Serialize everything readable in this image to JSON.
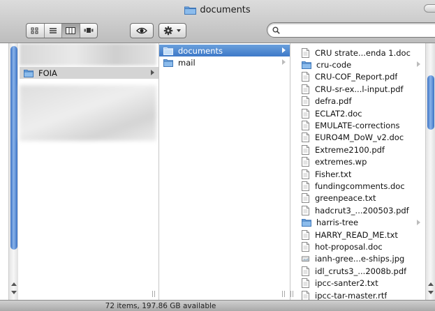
{
  "window": {
    "title": "documents"
  },
  "search": {
    "value": "",
    "placeholder": ""
  },
  "sidebar": {
    "items": [
      {
        "label": "FOIA",
        "icon": "folder-icon"
      }
    ]
  },
  "middle": {
    "items": [
      {
        "label": "documents",
        "icon": "folder-icon",
        "selected": true
      },
      {
        "label": "mail",
        "icon": "folder-icon",
        "selected": false
      }
    ]
  },
  "files": {
    "items": [
      {
        "label": "CRU strate...enda 1.doc",
        "icon": "doc-icon",
        "folder": false
      },
      {
        "label": "cru-code",
        "icon": "folder-icon",
        "folder": true
      },
      {
        "label": "CRU-COF_Report.pdf",
        "icon": "doc-icon",
        "folder": false
      },
      {
        "label": "CRU-sr-ex...l-input.pdf",
        "icon": "doc-icon",
        "folder": false
      },
      {
        "label": "defra.pdf",
        "icon": "doc-icon",
        "folder": false
      },
      {
        "label": "ECLAT2.doc",
        "icon": "doc-icon",
        "folder": false
      },
      {
        "label": "EMULATE-corrections",
        "icon": "doc-icon",
        "folder": false
      },
      {
        "label": "EURO4M_DoW_v2.doc",
        "icon": "doc-icon",
        "folder": false
      },
      {
        "label": "Extreme2100.pdf",
        "icon": "doc-icon",
        "folder": false
      },
      {
        "label": "extremes.wp",
        "icon": "doc-icon",
        "folder": false
      },
      {
        "label": "Fisher.txt",
        "icon": "doc-icon",
        "folder": false
      },
      {
        "label": "fundingcomments.doc",
        "icon": "doc-icon",
        "folder": false
      },
      {
        "label": "greenpeace.txt",
        "icon": "doc-icon",
        "folder": false
      },
      {
        "label": "hadcrut3_...200503.pdf",
        "icon": "doc-icon",
        "folder": false
      },
      {
        "label": "harris-tree",
        "icon": "folder-icon",
        "folder": true
      },
      {
        "label": "HARRY_READ_ME.txt",
        "icon": "doc-icon",
        "folder": false
      },
      {
        "label": "hot-proposal.doc",
        "icon": "doc-icon",
        "folder": false
      },
      {
        "label": "ianh-gree...e-ships.jpg",
        "icon": "image-icon",
        "folder": false
      },
      {
        "label": "idl_cruts3_...2008b.pdf",
        "icon": "doc-icon",
        "folder": false
      },
      {
        "label": "ipcc-santer2.txt",
        "icon": "doc-icon",
        "folder": false
      },
      {
        "label": "ipcc-tar-master.rtf",
        "icon": "doc-icon",
        "folder": false
      }
    ]
  },
  "status": {
    "text": "72 items, 197.86 GB available"
  },
  "colors": {
    "selection": "#3d78c8",
    "folder": "#6ea6e2",
    "scroll_thumb": "#3b72c3"
  }
}
